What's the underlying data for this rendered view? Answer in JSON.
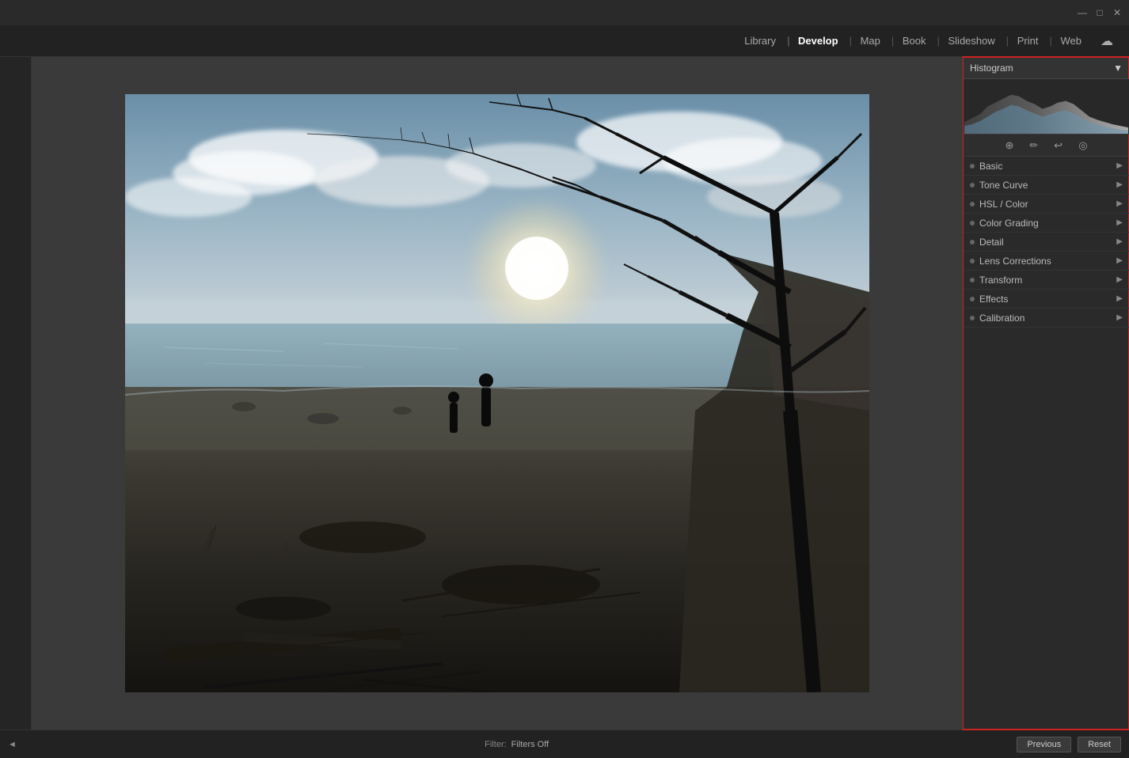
{
  "titlebar": {
    "minimize": "—",
    "maximize": "□",
    "close": "✕"
  },
  "nav": {
    "items": [
      {
        "label": "Library",
        "active": false
      },
      {
        "label": "Develop",
        "active": true
      },
      {
        "label": "Map",
        "active": false
      },
      {
        "label": "Book",
        "active": false
      },
      {
        "label": "Slideshow",
        "active": false
      },
      {
        "label": "Print",
        "active": false
      },
      {
        "label": "Web",
        "active": false
      }
    ]
  },
  "right_panel": {
    "histogram_label": "Histogram",
    "toolbar": {
      "icon1": "⊕",
      "icon2": "✏",
      "icon3": "↩",
      "icon4": "◎"
    },
    "sections": [
      {
        "label": "Basic",
        "active": false
      },
      {
        "label": "Tone Curve",
        "active": false
      },
      {
        "label": "HSL / Color",
        "active": false
      },
      {
        "label": "Color Grading",
        "active": false
      },
      {
        "label": "Detail",
        "active": false
      },
      {
        "label": "Lens Corrections",
        "active": false
      },
      {
        "label": "Transform",
        "active": false
      },
      {
        "label": "Effects",
        "active": false
      },
      {
        "label": "Calibration",
        "active": false
      }
    ]
  },
  "bottom": {
    "filter_label": "Filter:",
    "filter_value": "Filters Off",
    "prev_btn": "Previous",
    "reset_btn": "Reset",
    "scroll_arrow": "◄"
  }
}
